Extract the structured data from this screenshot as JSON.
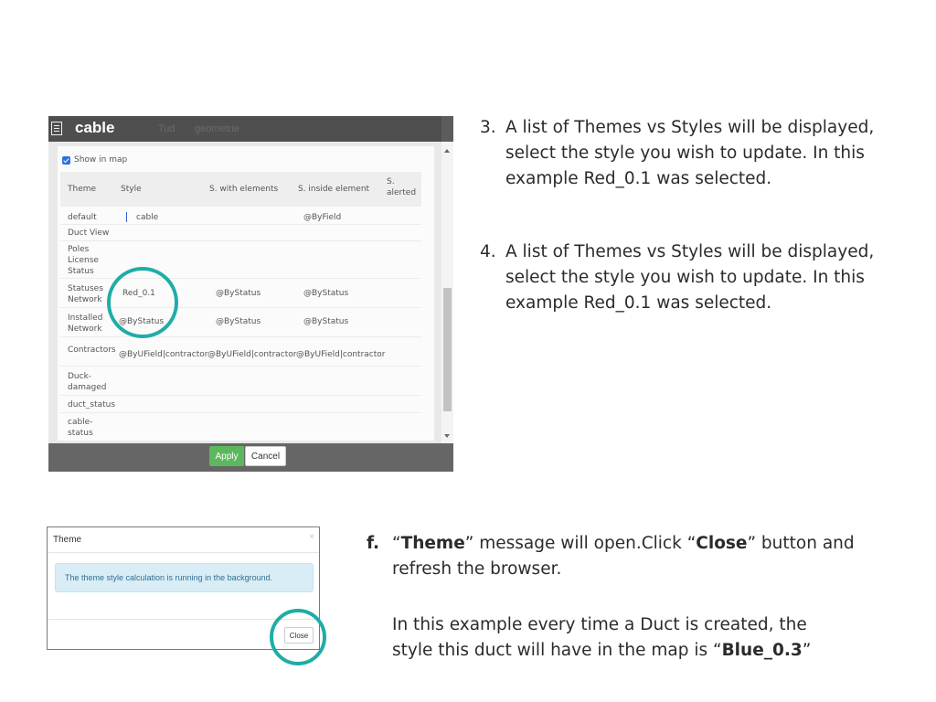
{
  "panel": {
    "title": "cable",
    "header_ghost_tabs": [
      "Tud",
      "geometrie"
    ],
    "show_in_map_label": "Show in map",
    "columns": [
      "Theme",
      "Style",
      "S. with elements",
      "S. inside element",
      "S. alerted"
    ],
    "rows": [
      {
        "theme": "default",
        "style": "cable",
        "with": "",
        "inside": "@ByField",
        "alerted": ""
      },
      {
        "theme": "Duct View",
        "style": "",
        "with": "",
        "inside": "",
        "alerted": ""
      },
      {
        "theme": "Poles License Status",
        "style": "",
        "with": "",
        "inside": "",
        "alerted": ""
      },
      {
        "theme": "Statuses Network",
        "style": "Red_0.1",
        "with": "@ByStatus",
        "inside": "@ByStatus",
        "alerted": ""
      },
      {
        "theme": "Installed Network",
        "style": "@ByStatus",
        "with": "@ByStatus",
        "inside": "@ByStatus",
        "alerted": ""
      },
      {
        "theme": "Contractors",
        "style": "@ByUField|contractor",
        "with": "@ByUField|contractor",
        "inside": "@ByUField|contractor",
        "alerted": ""
      },
      {
        "theme": "Duck-damaged",
        "style": "",
        "with": "",
        "inside": "",
        "alerted": ""
      },
      {
        "theme": "duct_status",
        "style": "",
        "with": "",
        "inside": "",
        "alerted": ""
      },
      {
        "theme": "cable-status",
        "style": "",
        "with": "",
        "inside": "",
        "alerted": ""
      }
    ],
    "apply_label": "Apply",
    "cancel_label": "Cancel"
  },
  "dialog": {
    "title": "Theme",
    "close_x": "×",
    "message": "The theme style calculation is running in the background.",
    "close_label": "Close"
  },
  "steps": {
    "step3_num": "3.",
    "step3_text": "A list of Themes vs Styles will be displayed, select the style you wish to update. In this example Red_0.1 was selected.",
    "step4_num": "4.",
    "step4_text": "A list of Themes vs Styles will be displayed, select the style you wish to update. In this example Red_0.1 was selected.",
    "f_num": "f.",
    "f_q1": "“",
    "f_bold1": "Theme",
    "f_mid": "” message will open.Click “",
    "f_bold2": "Close",
    "f_end": "” button and refresh the browser.",
    "note_pre": "In this example every time a Duct is created, the style this duct will have in the map is “",
    "note_bold": "Blue_0.3",
    "note_post": "”"
  },
  "colors": {
    "highlight": "#1fada6",
    "apply": "#5cb85c",
    "header": "#4f4f4f",
    "alert_bg": "#d9edf7"
  }
}
